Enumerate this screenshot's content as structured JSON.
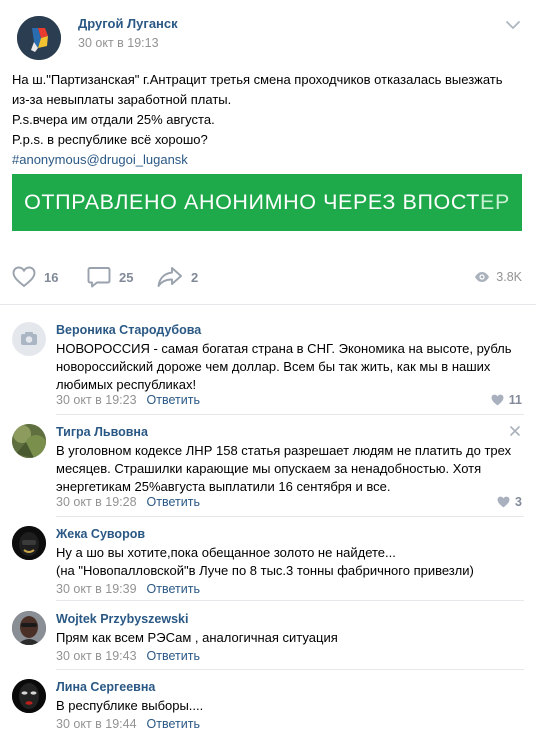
{
  "post": {
    "group_name": "Другой Луганск",
    "date": "30 окт в 19:13",
    "text_lines": [
      "На ш.\"Партизанская\" г.Антрацит третья смена проходчиков отказалась выезжать",
      "из-за невыплаты заработной платы.",
      "P.s.вчера им отдали 25% августа.",
      "P.p.s. в республике всё хорошо?"
    ],
    "hashtag": "#anonymous@drugoi_lugansk",
    "banner_main": "ОТПРАВЛЕНО АНОНИМНО ЧЕРЕЗ ВПОСТ",
    "banner_tail": "ЕР",
    "likes": "16",
    "comments": "25",
    "shares": "2",
    "views": "3.8K"
  },
  "comments": [
    {
      "name": "Вероника Стародубова",
      "text": "НОВОРОССИЯ - самая богатая страна в СНГ. Экономика на высоте, рубль новороссийский дороже чем доллар. Всем бы так жить, как мы в наших любимых республиках!",
      "date": "30 окт в 19:23",
      "reply": "Ответить",
      "likes": "11"
    },
    {
      "name": "Тигра Львовна",
      "text": "В уголовном кодексе ЛНР 158 статья разрешает людям не платить до трех месяцев. Страшилки карающие мы опускаем за ненадобностью. Хотя энергетикам 25%августа выплатили 16 сентября и все.",
      "date": "30 окт в 19:28",
      "reply": "Ответить",
      "likes": "3"
    },
    {
      "name": "Жека Суворов",
      "text_line1": "Ну а шо вы хотите,пока обещанное золото не найдете...",
      "text_line2": "(на \"Новопалловской\"в Луче по 8 тыс.3 тонны фабричного привезли)",
      "date": "30 окт в 19:39",
      "reply": "Ответить"
    },
    {
      "name": "Wojtek Przybyszewski",
      "text": "Прям как всем РЭСам , аналогичная ситуация",
      "date": "30 окт в 19:43",
      "reply": "Ответить"
    },
    {
      "name": "Лина Сергеевна",
      "text": "В республике выборы....",
      "date": "30 окт в 19:44",
      "reply": "Ответить"
    }
  ],
  "colors": {
    "link": "#2a5885",
    "banner": "#1ea94a",
    "meta": "#939393",
    "icon": "#828a99"
  },
  "icons": [
    "chevron-down-icon",
    "heart-icon",
    "comment-icon",
    "share-icon",
    "eye-icon",
    "camera-icon",
    "close-icon"
  ]
}
